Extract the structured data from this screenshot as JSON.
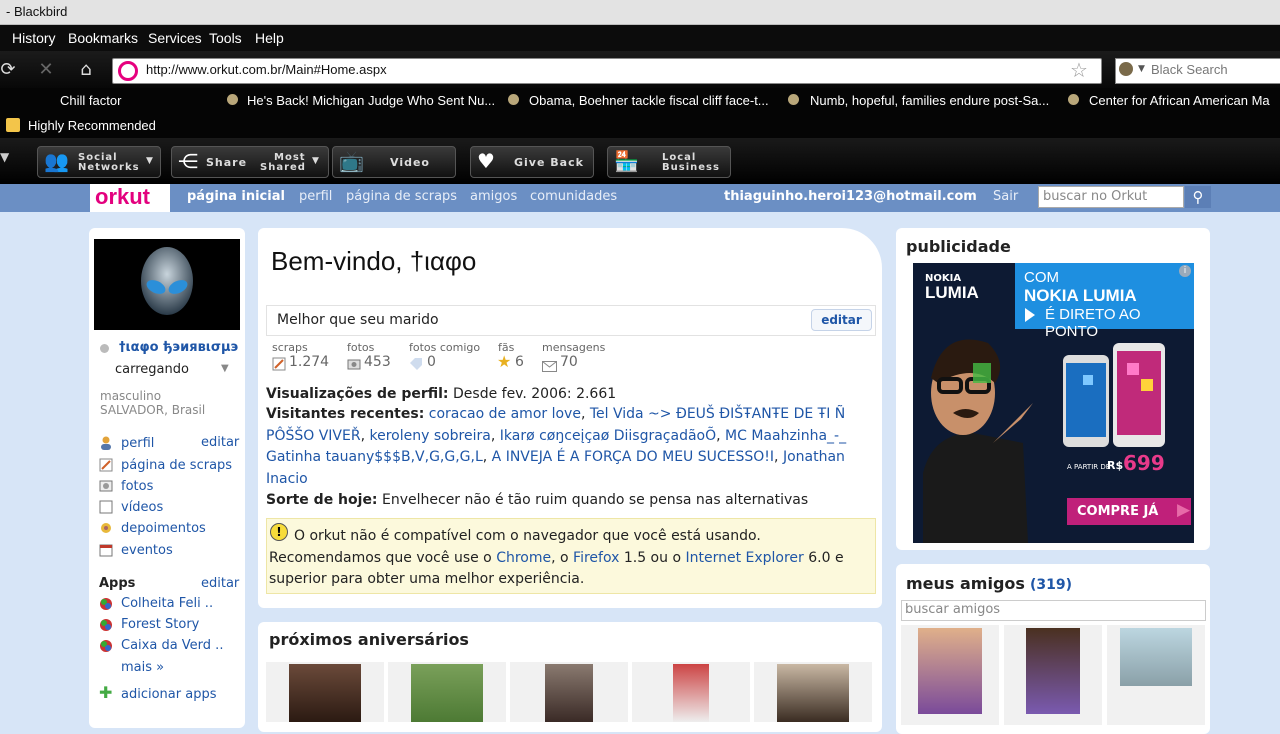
{
  "window": {
    "title": "- Blackbird"
  },
  "menu": [
    "History",
    "Bookmarks",
    "Services",
    "Tools",
    "Help"
  ],
  "address_bar": {
    "url": "http://www.orkut.com.br/Main#Home.aspx"
  },
  "browser_search": {
    "placeholder": "Black Search"
  },
  "bookmarks": [
    "Chill factor",
    "He's Back! Michigan Judge Who Sent Nu...",
    "Obama, Boehner tackle fiscal cliff face-t...",
    "Numb, hopeful, families endure post-Sa...",
    "Center for African American Ma"
  ],
  "highly_recommended": "Highly Recommended",
  "toolbar": {
    "social_1": "Social",
    "social_2": "Networks",
    "share": "Share",
    "most_1": "Most",
    "most_2": "Shared",
    "video": "Video",
    "give_back": "Give Back",
    "local_1": "Local",
    "local_2": "Business"
  },
  "orkut_nav": {
    "logo": "orkut",
    "home": "página inicial",
    "profile": "perfil",
    "scraps": "página de scraps",
    "friends": "amigos",
    "communities": "comunidades",
    "email": "thiaguinho.heroi123@hotmail.com",
    "logout": "Sair",
    "search_placeholder": "buscar no Orkut"
  },
  "sidebar": {
    "username": "†ιαφο ђэиявισµэ",
    "status": "carregando",
    "gender": "masculino",
    "location": "SALVADOR, Brasil",
    "items": [
      {
        "label": "perfil"
      },
      {
        "label": "página de scraps"
      },
      {
        "label": "fotos"
      },
      {
        "label": "vídeos"
      },
      {
        "label": "depoimentos"
      },
      {
        "label": "eventos"
      }
    ],
    "edit": "editar",
    "apps_title": "Apps",
    "apps_edit": "editar",
    "apps": [
      "Colheita Feli ..",
      "Forest Story",
      "Caixa da Verd .."
    ],
    "more": "mais »",
    "add_apps": "adicionar apps"
  },
  "main": {
    "welcome": "Bem-vindo, †ιαφο",
    "status_text": "Melhor que seu marido",
    "edit": "editar",
    "stats": [
      {
        "label": "scraps",
        "value": "1.274"
      },
      {
        "label": "fotos",
        "value": "453"
      },
      {
        "label": "fotos comigo",
        "value": "0"
      },
      {
        "label": "fãs",
        "value": "6"
      },
      {
        "label": "mensagens",
        "value": "70"
      }
    ],
    "views_label": "Visualizações de perfil:",
    "views_value": "Desde fev. 2006: 2.661",
    "visitors_label": "Visitantes recentes:",
    "visitors": [
      "coracao de amor love",
      "Tel Vida ~> ĐEUŠ ĐIŠŦANŦE DE ŦI Ñ PÔŠŠO VIVEŘ",
      "keroleny sobreira",
      "Ikarø cøŋceįçaø DiisgraçadãoÕ",
      "MC Maahzinha_-_ Gatinha tauany$$$B,V,G,G,G,L",
      "A INVEJA É A FORÇA DO MEU SUCESSO!I",
      "Jonathan Inacio"
    ],
    "luck_label": "Sorte de hoje:",
    "luck_value": "Envelhecer não é tão ruim quando se pensa nas alternativas",
    "warning_1": "O orkut não é compatível com o navegador que você está usando.",
    "warning_2": "Recomendamos que você use o",
    "chrome": "Chrome",
    "sep1": ", o",
    "firefox": "Firefox",
    "ff_ver": "1.5 ou o",
    "ie": "Internet Explorer",
    "ie_ver": "6.0 e",
    "warning_3": "superior para obter uma melhor experiência.",
    "birthdays_title": "próximos aniversários"
  },
  "ad": {
    "title": "publicidade",
    "brand_1": "NOKIA",
    "brand_2": "LUMIA",
    "com": "COM",
    "headline": "NOKIA LUMIA",
    "tagline": "É DIRETO AO PONTO",
    "price_prefix": "A PARTIR DE",
    "currency": "R$",
    "price": "699",
    "cta": "COMPRE JÁ"
  },
  "friends": {
    "title": "meus amigos",
    "count": "(319)",
    "search_placeholder": "buscar amigos"
  }
}
